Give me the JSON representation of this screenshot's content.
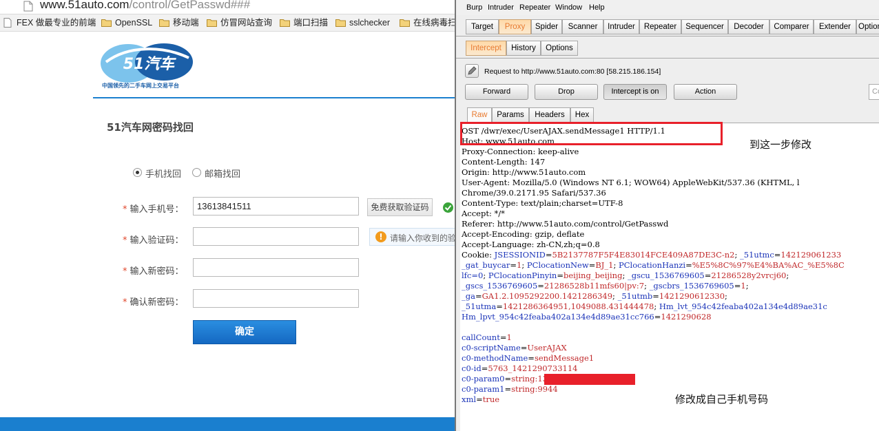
{
  "browser": {
    "url_host": "www.51auto.com",
    "url_path": "/control/GetPasswd###",
    "bookmarks": [
      {
        "label": "FEX 做最专业的前端",
        "icon": "page-icon"
      },
      {
        "label": "OpenSSL",
        "icon": "folder-icon"
      },
      {
        "label": "移动端",
        "icon": "folder-icon"
      },
      {
        "label": "仿冒网站查询",
        "icon": "folder-icon"
      },
      {
        "label": "端口扫描",
        "icon": "folder-icon"
      },
      {
        "label": "sslchecker",
        "icon": "folder-icon"
      },
      {
        "label": "在线病毒扫",
        "icon": "folder-icon"
      }
    ]
  },
  "site": {
    "logo_text": "51汽车",
    "tagline": "中国领先的二手车网上交易平台",
    "page_title": "51汽车网密码找回",
    "radio_phone": "手机找回",
    "radio_email": "邮箱找回",
    "phone_label": "输入手机号：",
    "phone_value": "13613841511",
    "sms_button": "免费获取验证码",
    "code_label": "输入验证码：",
    "code_hint": "请输入你收到的验",
    "newpwd_label": "输入新密码：",
    "confirm_label": "确认新密码：",
    "submit": "确定",
    "required_mark": "*",
    "brand_color": "#1a7fcf"
  },
  "burp": {
    "menu": [
      "Burp",
      "Intruder",
      "Repeater",
      "Window",
      "Help"
    ],
    "tabs": [
      "Target",
      "Proxy",
      "Spider",
      "Scanner",
      "Intruder",
      "Repeater",
      "Sequencer",
      "Decoder",
      "Comparer",
      "Extender",
      "Option"
    ],
    "active_tab": "Proxy",
    "subtabs": [
      "Intercept",
      "History",
      "Options"
    ],
    "active_subtab": "Intercept",
    "request_to": "Request to http://www.51auto.com:80  [58.215.186.154]",
    "buttons": {
      "forward": "Forward",
      "drop": "Drop",
      "intercept": "Intercept is on",
      "action": "Action"
    },
    "search_placeholder": "Co",
    "view_tabs": [
      "Raw",
      "Params",
      "Headers",
      "Hex"
    ],
    "active_view": "Raw",
    "request_lines": [
      [
        {
          "t": "OST /dwr/exec/UserAJAX.sendMessage1 HTTP/1.1",
          "c": "k"
        }
      ],
      [
        {
          "t": "Host: www.51auto.com",
          "c": "k"
        }
      ],
      [
        {
          "t": "Proxy-Connection: keep-alive",
          "c": "k"
        }
      ],
      [
        {
          "t": "Content-Length: 147",
          "c": "k"
        }
      ],
      [
        {
          "t": "Origin: http://www.51auto.com",
          "c": "k"
        }
      ],
      [
        {
          "t": "User-Agent: Mozilla/5.0 (Windows NT 6.1; WOW64) AppleWebKit/537.36 (KHTML, l",
          "c": "k"
        }
      ],
      [
        {
          "t": "Chrome/39.0.2171.95 Safari/537.36",
          "c": "k"
        }
      ],
      [
        {
          "t": "Content-Type: text/plain;charset=UTF-8",
          "c": "k"
        }
      ],
      [
        {
          "t": "Accept: */*",
          "c": "k"
        }
      ],
      [
        {
          "t": "Referer: http://www.51auto.com/control/GetPasswd",
          "c": "k"
        }
      ],
      [
        {
          "t": "Accept-Encoding: gzip, deflate",
          "c": "k"
        }
      ],
      [
        {
          "t": "Accept-Language: zh-CN,zh;q=0.8",
          "c": "k"
        }
      ],
      [
        {
          "t": "Cookie: ",
          "c": "k"
        },
        {
          "t": "JSESSIONID",
          "c": "blue"
        },
        {
          "t": "=",
          "c": "k"
        },
        {
          "t": "5B2137787F5F4E83014FCE409A87DE3C-n2",
          "c": "red"
        },
        {
          "t": "; ",
          "c": "k"
        },
        {
          "t": "_51utmc",
          "c": "blue"
        },
        {
          "t": "=",
          "c": "k"
        },
        {
          "t": "142129061233",
          "c": "red"
        }
      ],
      [
        {
          "t": "_gat_buycar",
          "c": "blue"
        },
        {
          "t": "=",
          "c": "k"
        },
        {
          "t": "1",
          "c": "red"
        },
        {
          "t": "; ",
          "c": "k"
        },
        {
          "t": "PClocationNew",
          "c": "blue"
        },
        {
          "t": "=",
          "c": "k"
        },
        {
          "t": "BJ_1",
          "c": "red"
        },
        {
          "t": "; ",
          "c": "k"
        },
        {
          "t": "PClocationHanzi",
          "c": "blue"
        },
        {
          "t": "=",
          "c": "k"
        },
        {
          "t": "%E5%8C%97%E4%BA%AC_%E5%8C",
          "c": "red"
        }
      ],
      [
        {
          "t": "lfc=0",
          "c": "blue"
        },
        {
          "t": "; ",
          "c": "k"
        },
        {
          "t": "PClocationPinyin",
          "c": "blue"
        },
        {
          "t": "=",
          "c": "k"
        },
        {
          "t": "beijing_beijing",
          "c": "red"
        },
        {
          "t": "; ",
          "c": "k"
        },
        {
          "t": "_gscu_1536769605",
          "c": "blue"
        },
        {
          "t": "=",
          "c": "k"
        },
        {
          "t": "21286528y2vrcj60",
          "c": "red"
        },
        {
          "t": ";",
          "c": "k"
        }
      ],
      [
        {
          "t": "_gscs_1536769605",
          "c": "blue"
        },
        {
          "t": "=",
          "c": "k"
        },
        {
          "t": "21286528b11mfs60|pv:7",
          "c": "red"
        },
        {
          "t": "; ",
          "c": "k"
        },
        {
          "t": "_gscbrs_1536769605",
          "c": "blue"
        },
        {
          "t": "=",
          "c": "k"
        },
        {
          "t": "1",
          "c": "red"
        },
        {
          "t": ";",
          "c": "k"
        }
      ],
      [
        {
          "t": "_ga",
          "c": "blue"
        },
        {
          "t": "=",
          "c": "k"
        },
        {
          "t": "GA1.2.1095292200.1421286349",
          "c": "red"
        },
        {
          "t": "; ",
          "c": "k"
        },
        {
          "t": "_51utmb",
          "c": "blue"
        },
        {
          "t": "=",
          "c": "k"
        },
        {
          "t": "1421290612330",
          "c": "red"
        },
        {
          "t": ";",
          "c": "k"
        }
      ],
      [
        {
          "t": "_51utma",
          "c": "blue"
        },
        {
          "t": "=",
          "c": "k"
        },
        {
          "t": "1421286364951,1049088.431444478",
          "c": "red"
        },
        {
          "t": "; ",
          "c": "k"
        },
        {
          "t": "Hm_lvt_954c42feaba402a134e4d89ae31c",
          "c": "blue"
        }
      ],
      [
        {
          "t": "Hm_lpvt_954c42feaba402a134e4d89ae31cc766",
          "c": "blue"
        },
        {
          "t": "=",
          "c": "k"
        },
        {
          "t": "1421290628",
          "c": "red"
        }
      ],
      [
        {
          "t": "",
          "c": "k"
        }
      ],
      [
        {
          "t": "callCount",
          "c": "blue"
        },
        {
          "t": "=",
          "c": "k"
        },
        {
          "t": "1",
          "c": "red"
        }
      ],
      [
        {
          "t": "c0-scriptName",
          "c": "blue"
        },
        {
          "t": "=",
          "c": "k"
        },
        {
          "t": "UserAJAX",
          "c": "red"
        }
      ],
      [
        {
          "t": "c0-methodName",
          "c": "blue"
        },
        {
          "t": "=",
          "c": "k"
        },
        {
          "t": "sendMessage1",
          "c": "red"
        }
      ],
      [
        {
          "t": "c0-id",
          "c": "blue"
        },
        {
          "t": "=",
          "c": "k"
        },
        {
          "t": "5763_1421290733114",
          "c": "red"
        }
      ],
      [
        {
          "t": "c0-param0",
          "c": "blue"
        },
        {
          "t": "=",
          "c": "k"
        },
        {
          "t": "string:13613841511",
          "c": "red"
        }
      ],
      [
        {
          "t": "c0-param1",
          "c": "blue"
        },
        {
          "t": "=",
          "c": "k"
        },
        {
          "t": "string:9944",
          "c": "red"
        }
      ],
      [
        {
          "t": "xml",
          "c": "blue"
        },
        {
          "t": "=",
          "c": "k"
        },
        {
          "t": "true",
          "c": "red"
        }
      ]
    ],
    "annotation_top": "到这一步修改",
    "annotation_bottom": "修改成自己手机号码",
    "highlight_color": "#e8202a"
  }
}
